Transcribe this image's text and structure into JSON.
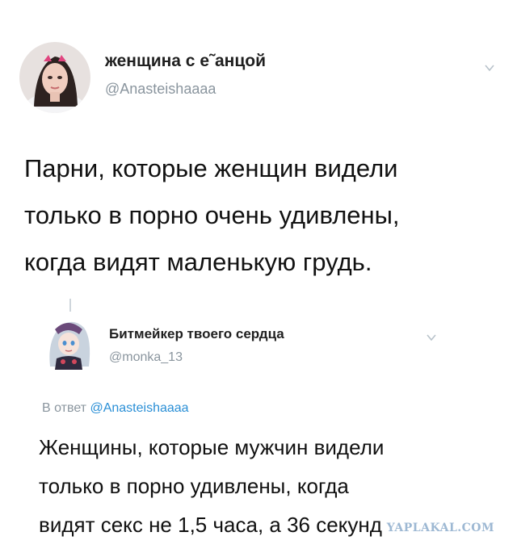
{
  "tweet1": {
    "display_name": "женщина с е˜анцой",
    "handle": "@Anasteishaaaa",
    "lines": [
      "Парни, которые женщин видели",
      "только в порно очень удивлены,",
      "когда видят маленькую грудь."
    ]
  },
  "tweet2": {
    "display_name": "Битмейкер твоего сердца",
    "handle": "@monka_13",
    "reply_prefix": "В ответ",
    "reply_handle": "@Anasteishaaaa",
    "lines": [
      "Женщины, которые мужчин видели",
      "только в порно удивлены, когда",
      "видят секс не 1,5 часа, а 36 секунд"
    ]
  },
  "watermark": "YAPLAKAL.COM",
  "icons": [
    "avatar-photo",
    "avatar-anime",
    "chevron-down-icon"
  ],
  "colors": {
    "handle": "#8a959e",
    "link": "#2a8fd6",
    "chevron": "#b8c2ca"
  }
}
